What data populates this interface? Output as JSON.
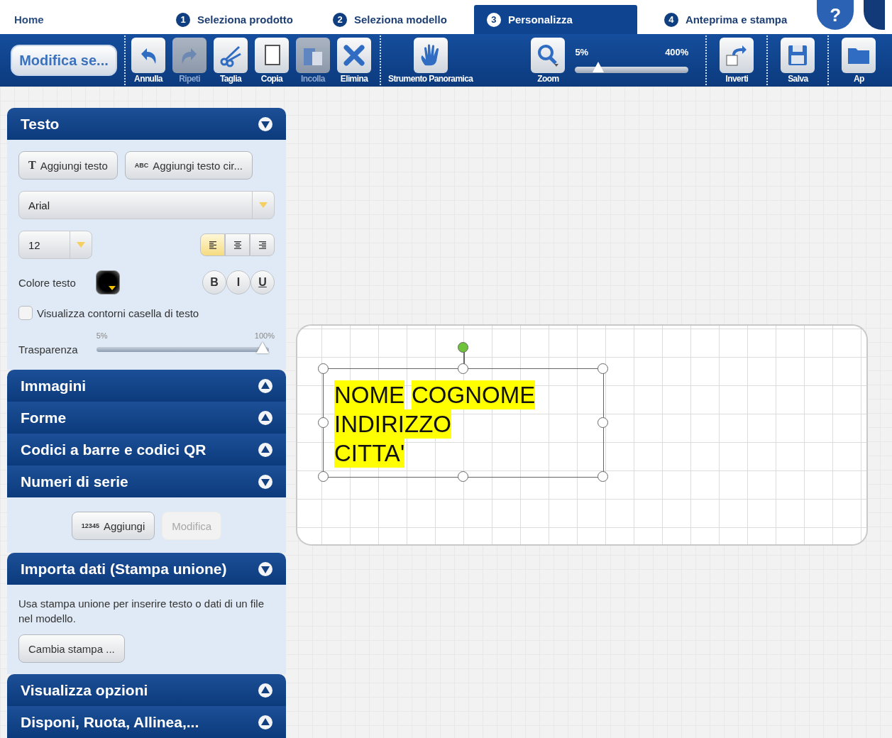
{
  "nav": {
    "home": "Home",
    "steps": [
      {
        "number": "1",
        "label": "Seleziona prodotto",
        "selected": false
      },
      {
        "number": "2",
        "label": "Seleziona modello",
        "selected": false
      },
      {
        "number": "3",
        "label": "Personalizza",
        "selected": true
      },
      {
        "number": "4",
        "label": "Anteprima e stampa",
        "selected": false
      }
    ],
    "help": "?"
  },
  "toolbar": {
    "edit_button": "Modifica se...",
    "tools": [
      {
        "kind": "undo",
        "label": "Annulla",
        "disabled": false
      },
      {
        "kind": "redo",
        "label": "Ripeti",
        "disabled": true
      },
      {
        "kind": "cut",
        "label": "Taglia",
        "disabled": false
      },
      {
        "kind": "copy",
        "label": "Copia",
        "disabled": false
      },
      {
        "kind": "paste",
        "label": "Incolla",
        "disabled": true
      },
      {
        "kind": "delete",
        "label": "Elimina",
        "disabled": false
      }
    ],
    "pan": {
      "kind": "hand",
      "label": "Strumento Panoramica"
    },
    "zoom": {
      "kind": "zoom",
      "label": "Zoom",
      "min": "5%",
      "max": "400%",
      "level": 0.17
    },
    "right_tools": [
      {
        "kind": "flip",
        "label": "Inverti"
      },
      {
        "kind": "save",
        "label": "Salva"
      },
      {
        "kind": "open",
        "label": "Ap"
      }
    ]
  },
  "sidebar": {
    "panels": [
      {
        "kind": "text",
        "title": "Testo",
        "expanded": true
      },
      {
        "title": "Immagini",
        "expanded": false
      },
      {
        "title": "Forme",
        "expanded": false
      },
      {
        "title": "Codici a barre e codici QR",
        "expanded": false
      },
      {
        "kind": "serial",
        "title": "Numeri di serie",
        "expanded": true
      },
      {
        "kind": "merge",
        "title": "Importa dati (Stampa unione)",
        "expanded": true
      },
      {
        "title": "Visualizza opzioni",
        "expanded": false
      },
      {
        "title": "Disponi, Ruota, Allinea,...",
        "expanded": false
      }
    ],
    "text": {
      "add_text": "Aggiungi testo",
      "add_text_icon": "T",
      "add_curved": "Aggiungi testo cir...",
      "add_curved_icon": "ABC",
      "font": "Arial",
      "size": "12",
      "align": [
        {
          "kind": "left",
          "selected": true
        },
        {
          "kind": "center",
          "selected": false
        },
        {
          "kind": "right",
          "selected": false
        }
      ],
      "color_label": "Colore testo",
      "color": "#000000",
      "styles": [
        "B",
        "I",
        "U"
      ],
      "outline": {
        "label": "Visualizza contorni casella di testo",
        "checked": false
      },
      "transparency": {
        "label": "Trasparenza",
        "min": "5%",
        "max": "100%",
        "level": 1
      }
    },
    "serial": {
      "add_icon": "12345",
      "add": "Aggiungi",
      "edit": "Modifica",
      "edit_disabled": true
    },
    "merge": {
      "description": "Usa stampa unione per inserire testo o dati di un file nel modello.",
      "button": "Cambia stampa ..."
    }
  },
  "canvas": {
    "lines": [
      "NOME COGNOME",
      "INDIRIZZO",
      "CITTA'"
    ]
  }
}
